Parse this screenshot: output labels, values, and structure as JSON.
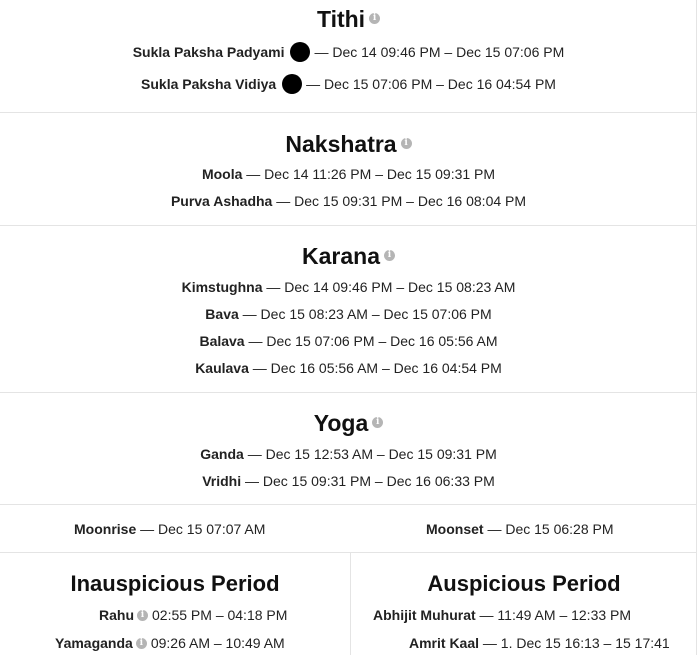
{
  "tithi": {
    "title": "Tithi",
    "rows": [
      {
        "name": "Sukla Paksha Padyami",
        "time": "— Dec 14 09:46 PM – Dec 15 07:06 PM"
      },
      {
        "name": "Sukla Paksha Vidiya",
        "time": "— Dec 15 07:06 PM – Dec 16 04:54 PM"
      }
    ]
  },
  "nakshatra": {
    "title": "Nakshatra",
    "rows": [
      {
        "name": "Moola",
        "time": "— Dec 14 11:26 PM – Dec 15 09:31 PM"
      },
      {
        "name": "Purva Ashadha",
        "time": "— Dec 15 09:31 PM – Dec 16 08:04 PM"
      }
    ]
  },
  "karana": {
    "title": "Karana",
    "rows": [
      {
        "name": "Kimstughna",
        "time": "— Dec 14 09:46 PM – Dec 15 08:23 AM"
      },
      {
        "name": "Bava",
        "time": "— Dec 15 08:23 AM – Dec 15 07:06 PM"
      },
      {
        "name": "Balava",
        "time": "— Dec 15 07:06 PM – Dec 16 05:56 AM"
      },
      {
        "name": "Kaulava",
        "time": "— Dec 16 05:56 AM – Dec 16 04:54 PM"
      }
    ]
  },
  "yoga": {
    "title": "Yoga",
    "rows": [
      {
        "name": "Ganda",
        "time": "— Dec 15 12:53 AM – Dec 15 09:31 PM"
      },
      {
        "name": "Vridhi",
        "time": "— Dec 15 09:31 PM – Dec 16 06:33 PM"
      }
    ]
  },
  "moon": {
    "moonrise_label": "Moonrise",
    "moonrise_time": "— Dec 15 07:07 AM",
    "moonset_label": "Moonset",
    "moonset_time": "— Dec 15 06:28 PM"
  },
  "inauspicious": {
    "title": "Inauspicious Period",
    "rows": [
      {
        "name": "Rahu",
        "time": "02:55 PM – 04:18 PM"
      },
      {
        "name": "Yamaganda",
        "time": "09:26 AM – 10:49 AM"
      }
    ]
  },
  "auspicious": {
    "title": "Auspicious Period",
    "rows": [
      {
        "name": "Abhijit Muhurat",
        "time": "— 11:49 AM – 12:33 PM"
      },
      {
        "name": "Amrit Kaal",
        "time": "— 1. Dec 15 16:13 – 15 17:41"
      }
    ]
  },
  "info_glyph": "i",
  "icons": {
    "info": "info-icon",
    "moon_phase": "new-moon-icon"
  },
  "colors": {
    "text": "#222222",
    "heading": "#111111",
    "info_icon": "#b5b5b5",
    "divider": "#e4e4e4",
    "moon": "#000000"
  }
}
